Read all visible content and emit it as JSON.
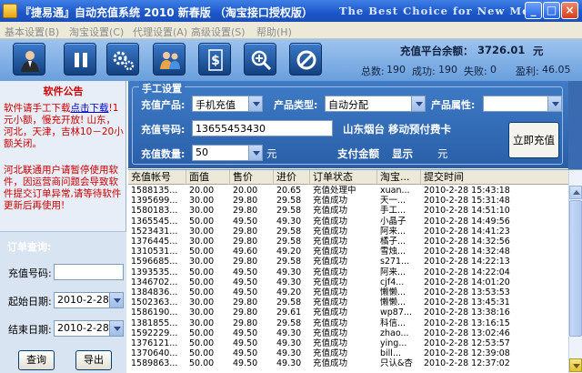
{
  "window": {
    "title": "『捷易通』自动充值系统 2010 新春版 （淘宝接口授权版）",
    "slogan": "The Best Choice for New Me...",
    "min": "_",
    "max": "□",
    "close": "×"
  },
  "menu": [
    "基本设置(B)",
    "淘宝设置(C)",
    "代理设置(A)",
    "高级设置(S)",
    "帮助(H)"
  ],
  "toolbar_icons": [
    "user-icon",
    "pause-icon",
    "settings-gears-icon",
    "users-icon",
    "dollar-icon",
    "magnifier-plus-icon",
    "stop-icon"
  ],
  "stats": {
    "balance_label": "充值平台余额：",
    "balance_value": "3726.01",
    "balance_unit": "元",
    "total_label": "总数:",
    "total": "190",
    "success_label": "成功:",
    "success": "190",
    "fail_label": "失败:",
    "fail": "0",
    "profit_label": "盈利:",
    "profit": "46.05"
  },
  "left": {
    "notice_title": "软件公告",
    "notice_pre": "软件请手工下载",
    "notice_link": "点击下载",
    "notice_post": "!1元小额，慢充开放! 山东，河北，天津，吉林10－20小额关闭。",
    "notice2": "河北联通用户请暂停使用软件，因运营商问题会导致软件提交订单异常,请等待软件更新后再使用!",
    "query_title": "订单查询:",
    "order_label": "充值号码:",
    "order_value": "",
    "start_label": "起始日期:",
    "start_value": "2010-2-28",
    "end_label": "结束日期:",
    "end_value": "2010-2-28",
    "query_btn": "查询",
    "export_btn": "导出"
  },
  "manual": {
    "title": "手工设置",
    "product_label": "充值产品:",
    "product_value": "手机充值",
    "type_label": "产品类型:",
    "type_value": "自动分配",
    "attr_label": "产品属性:",
    "attr_value": "",
    "number_label": "充值号码:",
    "number_value": "13655453430",
    "carrier": "山东烟台 移动预付费卡",
    "qty_label": "充值数量:",
    "qty_value": "50",
    "qty_unit": "元",
    "pay_label": "支付金额",
    "pay_show": "显示",
    "pay_unit": "元",
    "submit": "立即充值"
  },
  "table": {
    "headers": [
      "充值帐号",
      "面值",
      "售价",
      "进价",
      "订单状态",
      "淘宝...",
      "提交时间"
    ],
    "rows": [
      [
        "1588135...",
        "20.00",
        "20.00",
        "20.65",
        "充值处理中",
        "xuan...",
        "2010-2-28 15:43:18"
      ],
      [
        "1395699...",
        "30.00",
        "29.80",
        "29.58",
        "充值成功",
        "天一...",
        "2010-2-28 15:31:48"
      ],
      [
        "1580183...",
        "30.00",
        "29.80",
        "29.58",
        "充值成功",
        "手工...",
        "2010-2-28 14:51:10"
      ],
      [
        "1365545...",
        "50.00",
        "49.50",
        "49.30",
        "充值成功",
        "小晶子",
        "2010-2-28 14:49:56"
      ],
      [
        "1523431...",
        "30.00",
        "29.80",
        "29.58",
        "充值成功",
        "阿来...",
        "2010-2-28 14:41:23"
      ],
      [
        "1376445...",
        "30.00",
        "29.80",
        "29.58",
        "充值成功",
        "橘子...",
        "2010-2-28 14:32:56"
      ],
      [
        "1310531...",
        "50.00",
        "49.60",
        "49.20",
        "充值成功",
        "雪烛...",
        "2010-2-28 14:32:48"
      ],
      [
        "1596685...",
        "30.00",
        "29.80",
        "29.58",
        "充值成功",
        "s271...",
        "2010-2-28 14:22:13"
      ],
      [
        "1393535...",
        "50.00",
        "49.50",
        "49.30",
        "充值成功",
        "阿来...",
        "2010-2-28 14:22:04"
      ],
      [
        "1346702...",
        "50.00",
        "49.50",
        "49.30",
        "充值成功",
        "cjf4...",
        "2010-2-28 14:01:20"
      ],
      [
        "1384836...",
        "50.00",
        "49.50",
        "49.20",
        "充值成功",
        "懒懒...",
        "2010-2-28 13:53:53"
      ],
      [
        "1502363...",
        "30.00",
        "29.80",
        "29.58",
        "充值成功",
        "懒懒...",
        "2010-2-28 13:45:31"
      ],
      [
        "1586190...",
        "30.00",
        "29.80",
        "29.61",
        "充值成功",
        "wp87...",
        "2010-2-28 13:38:16"
      ],
      [
        "1381855...",
        "30.00",
        "29.80",
        "29.58",
        "充值成功",
        "科信...",
        "2010-2-28 13:16:15"
      ],
      [
        "1592229...",
        "50.00",
        "49.50",
        "49.30",
        "充值成功",
        "zhao...",
        "2010-2-28 13:02:46"
      ],
      [
        "1376121...",
        "50.00",
        "49.50",
        "49.30",
        "充值成功",
        "ying...",
        "2010-2-28 12:53:57"
      ],
      [
        "1370640...",
        "50.00",
        "49.50",
        "49.30",
        "充值成功",
        "bill...",
        "2010-2-28 12:39:08"
      ],
      [
        "1589863...",
        "50.00",
        "49.50",
        "49.30",
        "充值成功",
        "只认&杏",
        "2010-2-28 12:37:02"
      ]
    ]
  }
}
